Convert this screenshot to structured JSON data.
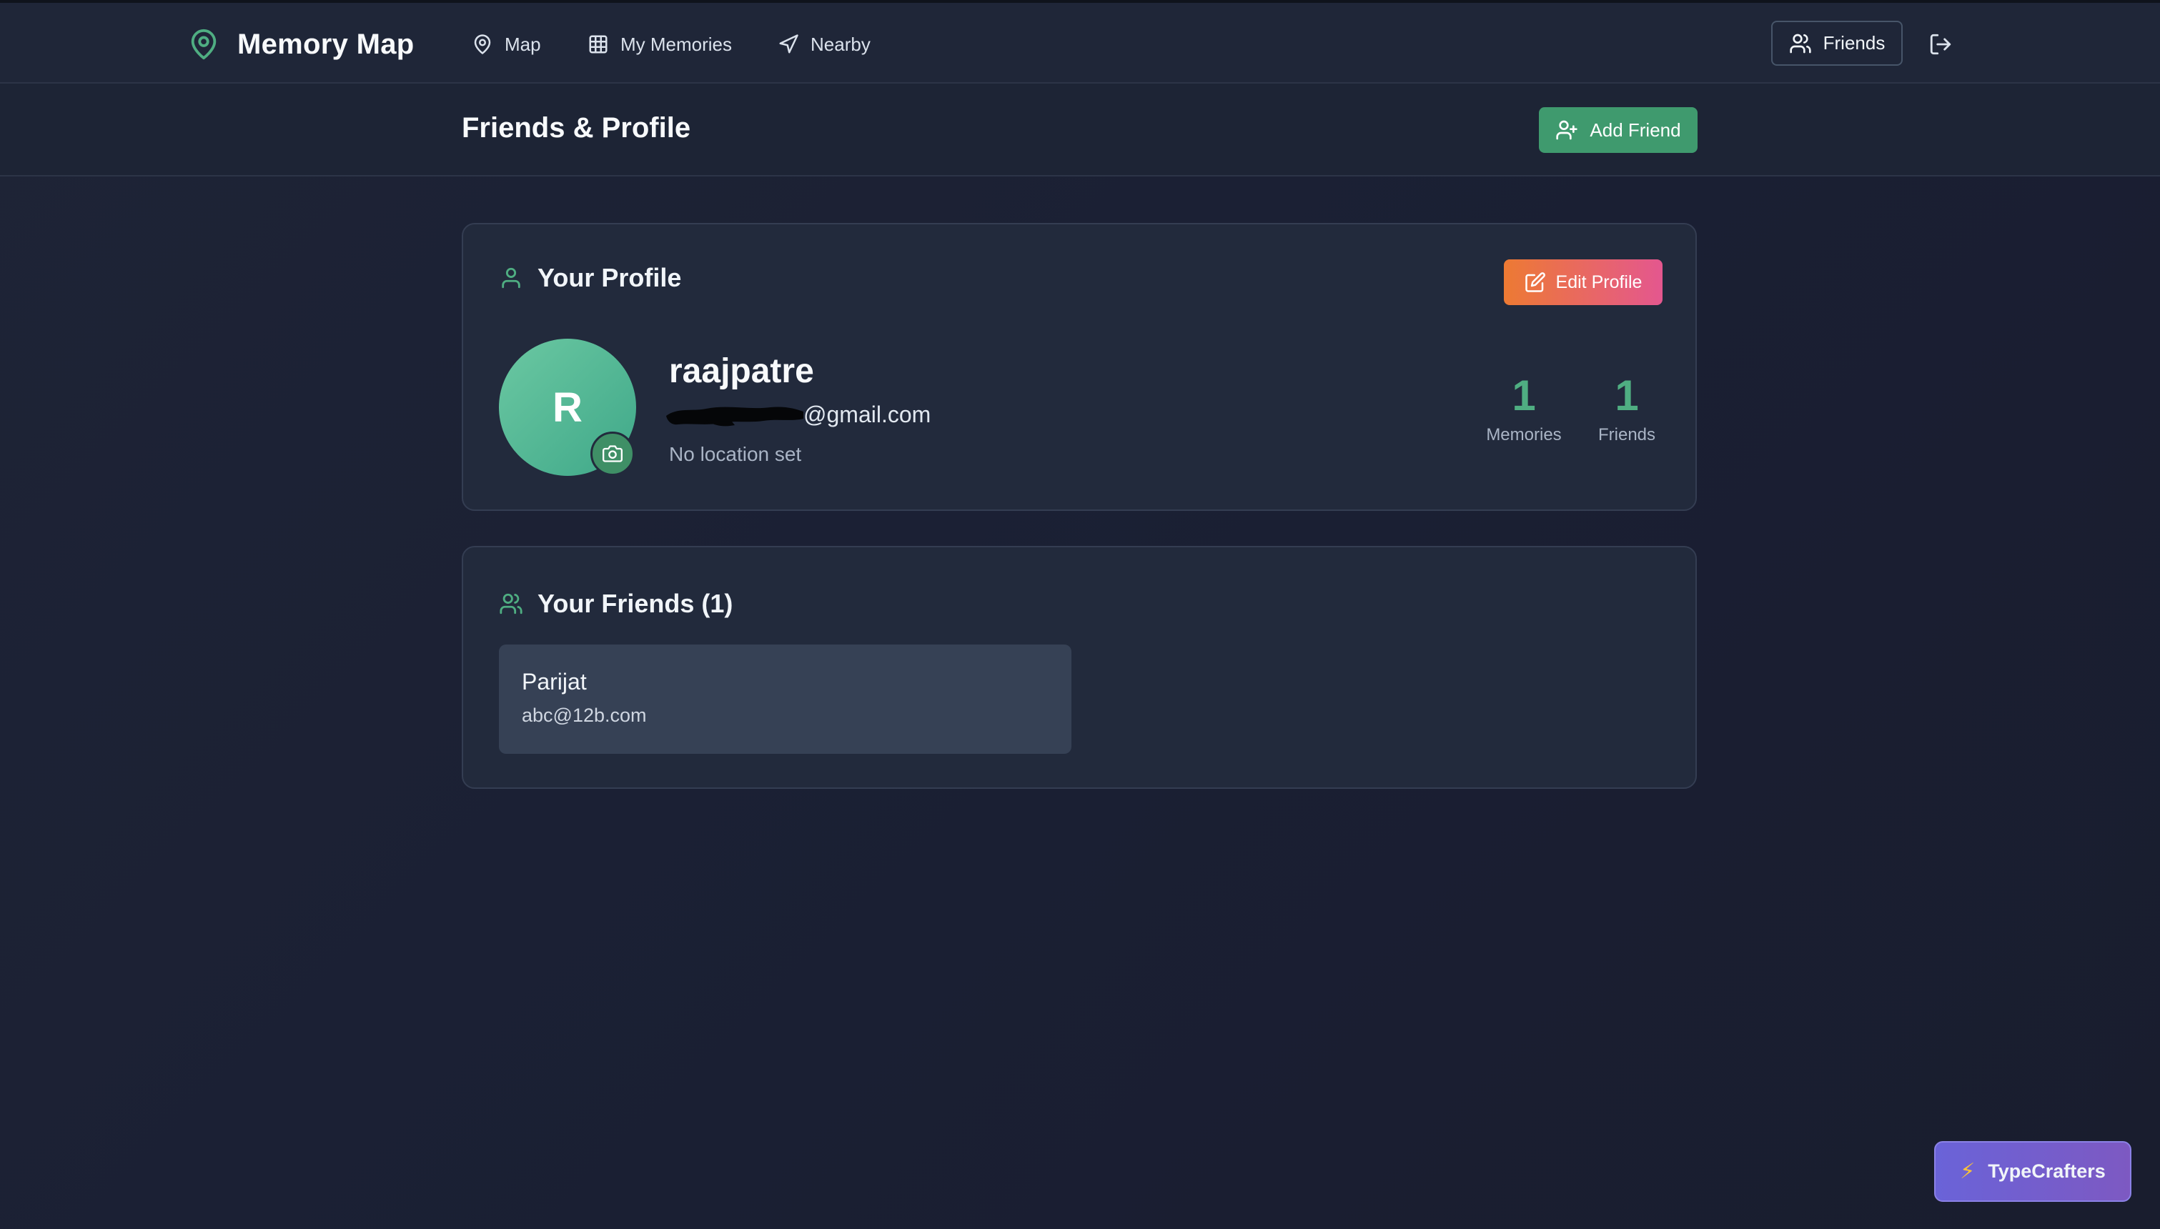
{
  "app": {
    "title": "Memory Map"
  },
  "nav": {
    "items": [
      {
        "label": "Map",
        "icon": "map-pin-icon"
      },
      {
        "label": "My Memories",
        "icon": "grid-icon"
      },
      {
        "label": "Nearby",
        "icon": "navigation-icon"
      }
    ],
    "friends_label": "Friends",
    "logout_icon": "log-out-icon"
  },
  "header": {
    "title": "Friends & Profile",
    "add_friend_label": "Add Friend"
  },
  "profile": {
    "heading": "Your Profile",
    "edit_label": "Edit Profile",
    "avatar_initial": "R",
    "username": "raajpatre",
    "email_visible": "@gmail.com",
    "location": "No location set",
    "stats": [
      {
        "value": "1",
        "label": "Memories"
      },
      {
        "value": "1",
        "label": "Friends"
      }
    ]
  },
  "friends": {
    "heading": "Your Friends (1)",
    "list": [
      {
        "name": "Parijat",
        "email": "abc@12b.com"
      }
    ]
  },
  "badge": {
    "label": "TypeCrafters",
    "icon": "lightning-icon"
  },
  "colors": {
    "accent_green": "#3f9a6e",
    "stat_green": "#4fae82",
    "edit_gradient_start": "#ed7a33",
    "edit_gradient_end": "#e4578f",
    "badge_purple": "#6a63d8"
  }
}
